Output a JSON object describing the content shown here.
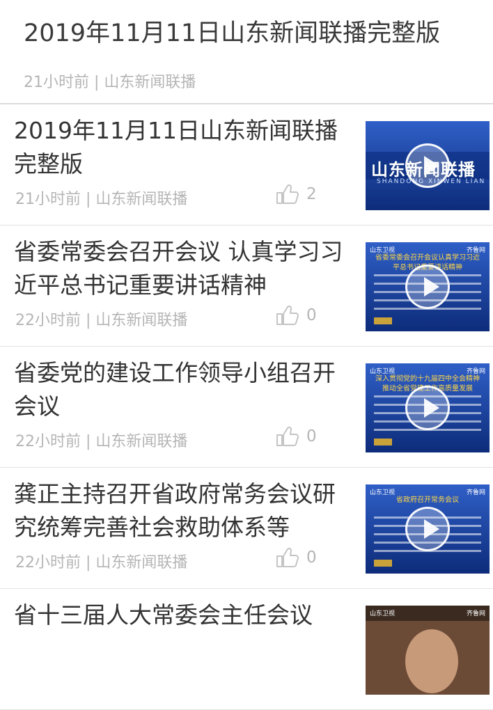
{
  "header": {
    "title": "2019年11月11日山东新闻联播完整版",
    "meta": "21小时前 | 山东新闻联播"
  },
  "items": [
    {
      "title": "2019年11月11日山东新闻联播完整版",
      "time": "21小时前",
      "source": "山东新闻联播",
      "likes": "2",
      "thumb": {
        "type": "logo",
        "logo": "山东新闻联播",
        "sub": "SHANDONG XINWEN LIAN BO"
      }
    },
    {
      "title": "省委常委会召开会议 认真学习习近平总书记重要讲话精神",
      "time": "22小时前",
      "source": "山东新闻联播",
      "likes": "0",
      "thumb": {
        "type": "text",
        "brand": "山东卫视",
        "badge": "齐鲁网",
        "caption": "省委常委会召开会议认真学习习近平总书记重要讲话精神"
      }
    },
    {
      "title": "省委党的建设工作领导小组召开会议",
      "time": "22小时前",
      "source": "山东新闻联播",
      "likes": "0",
      "thumb": {
        "type": "text",
        "brand": "山东卫视",
        "badge": "齐鲁网",
        "caption": "深入贯彻党的十九届四中全会精神推动全省党建工作高质量发展"
      }
    },
    {
      "title": "龚正主持召开省政府常务会议研究统筹完善社会救助体系等",
      "time": "22小时前",
      "source": "山东新闻联播",
      "likes": "0",
      "thumb": {
        "type": "text",
        "brand": "山东卫视",
        "badge": "齐鲁网",
        "caption": "省政府召开常务会议"
      }
    },
    {
      "title": "省十三届人大常委会主任会议",
      "time": "",
      "source": "",
      "likes": "",
      "thumb": {
        "type": "person",
        "brand": "山东卫视",
        "badge": "齐鲁网"
      }
    }
  ],
  "separator": "|",
  "icons": {
    "like": "thumbs-up-icon",
    "play": "play-icon"
  },
  "colors": {
    "meta_text": "#b5b5b5",
    "title_text": "#333333",
    "thumb_blue": "#1a3f9a"
  }
}
